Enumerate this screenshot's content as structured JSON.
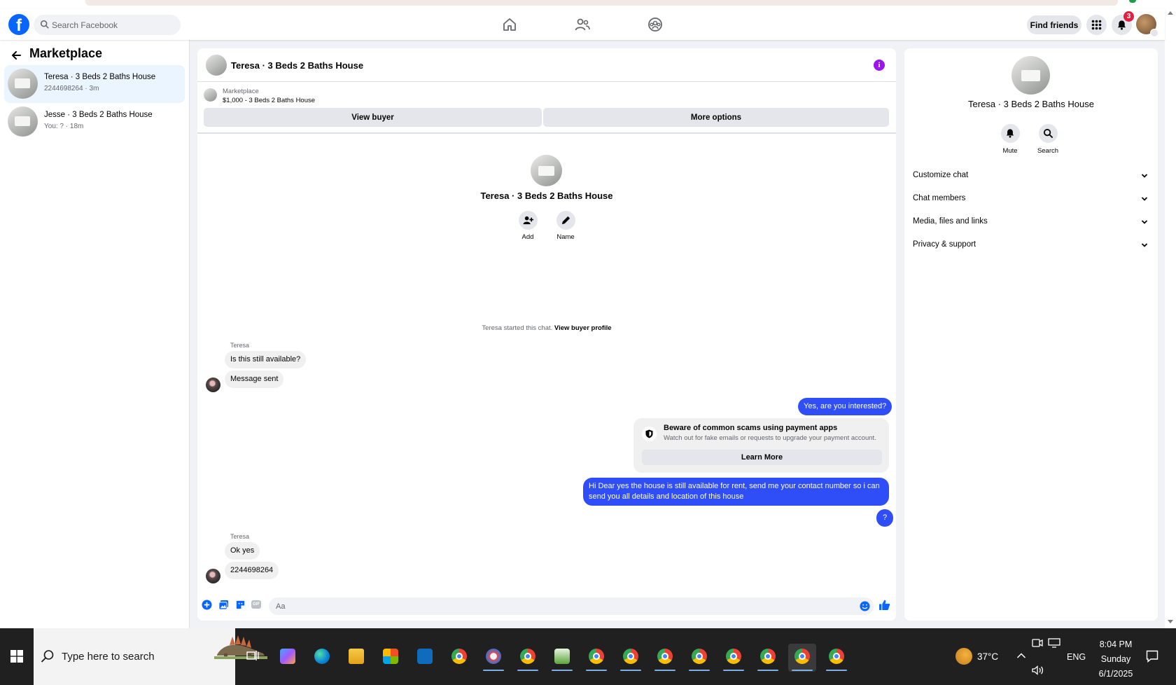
{
  "header": {
    "search_placeholder": "Search Facebook",
    "find_friends_label": "Find friends",
    "notification_count": "3",
    "logo_text": "f"
  },
  "sidebar": {
    "title": "Marketplace",
    "conversations": [
      {
        "name": "Teresa · 3 Beds 2 Baths House",
        "meta": "2244698264 · 3m",
        "active": true
      },
      {
        "name": "Jesse · 3 Beds 2 Baths House",
        "meta": "You: ? · 18m",
        "active": false
      }
    ]
  },
  "chat": {
    "title": "Teresa · 3 Beds 2 Baths House",
    "info_icon": "i",
    "listing": {
      "source": "Marketplace",
      "price_title": "$1,000 - 3 Beds 2 Baths House",
      "view_buyer_label": "View buyer",
      "more_options_label": "More options"
    },
    "intro": {
      "name": "Teresa · 3 Beds 2 Baths House",
      "add_label": "Add",
      "name_label": "Name"
    },
    "started_text": "Teresa started this chat.",
    "view_profile_label": "View buyer profile",
    "messages": {
      "sender1": "Teresa",
      "in1": "Is this still available?",
      "in2": "Message sent",
      "out1": "Yes, are you interested?",
      "out2": "Hi Dear yes the house is still available for rent, send me your contact number so i can send you all details and location of this house",
      "out3": "?",
      "sender2": "Teresa",
      "in3": "Ok yes",
      "in4": "2244698264"
    },
    "scam_warning": {
      "title": "Beware of common scams using payment apps",
      "description": "Watch out for fake emails or requests to upgrade your payment account.",
      "learn_more_label": "Learn More"
    },
    "composer": {
      "placeholder": "Aa",
      "gif_label": "GIF"
    }
  },
  "right_panel": {
    "name": "Teresa · 3 Beds 2 Baths House",
    "mute_label": "Mute",
    "search_label": "Search",
    "sections": [
      "Customize chat",
      "Chat members",
      "Media, files and links",
      "Privacy & support"
    ]
  },
  "taskbar": {
    "search_placeholder": "Type here to search",
    "temperature": "37°C",
    "language": "ENG",
    "time": "8:04 PM",
    "day": "Sunday",
    "date": "6/1/2025"
  },
  "colors": {
    "brand_blue": "#0866ff",
    "outgoing_bubble": "#2f4ef7",
    "active_conversation": "#ebf5ff",
    "info_purple": "#9b15f2",
    "badge_red": "#e41e3f"
  }
}
